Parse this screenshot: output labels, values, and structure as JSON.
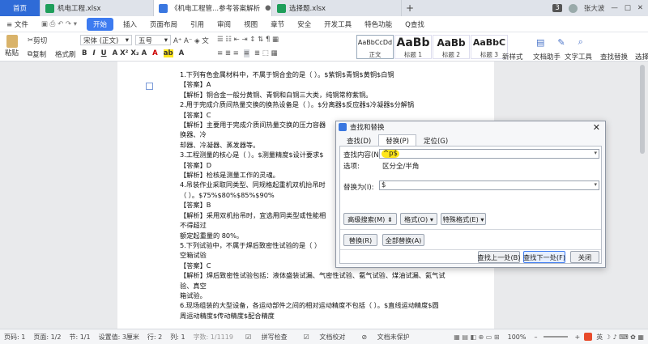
{
  "tabs": [
    {
      "label": "首页"
    },
    {
      "label": "机电工程.xlsx"
    },
    {
      "label": "《机电工程管...参考答案解析"
    },
    {
      "label": "选择题.xlsx"
    }
  ],
  "tabbar_right": {
    "badge": "3",
    "user": "张大波"
  },
  "menu": {
    "file": "≡ 文件",
    "items": [
      "开始",
      "插入",
      "页面布局",
      "引用",
      "审阅",
      "视图",
      "章节",
      "安全",
      "开发工具",
      "特色功能"
    ],
    "search": "Q查找"
  },
  "ribbon": {
    "paste": "粘贴",
    "cut": "剪切",
    "copy": "复制",
    "format_painter": "格式刷",
    "font": "宋体 (正文)",
    "size": "五号",
    "styles": [
      {
        "sample": "AaBbCcDd",
        "name": "正文"
      },
      {
        "sample": "AaBb",
        "name": "标题 1"
      },
      {
        "sample": "AaBb",
        "name": "标题 2"
      },
      {
        "sample": "AaBbC",
        "name": "标题 3"
      }
    ],
    "new_style": "新样式",
    "doc_helper": "文档助手",
    "text_tools": "文字工具",
    "find_replace": "查找替换",
    "select": "选择"
  },
  "document": {
    "lines": [
      "1.下列有色金属材料中，不属于铜合金的是（  ）。$紫铜$青铜$黄铜$白铜",
      "【答案】A",
      "【解析】铜合金一般分黄铜、青铜和白铜三大类，纯铜常称紫铜。",
      "2.用于完成介质间热量交换的换热设备是（  ）。$分离器$反应器$冷凝器$分解锅",
      "【答案】C",
      "【解析】主要用于完成介质间热量交换的压力容器",
      "换器、冷",
      "却器、冷凝器、蒸发器等。",
      "3.工程测量的核心是（  ）。$测量精度$设计要求$",
      "【答案】D",
      "【解析】检核是测量工作的灵魂。",
      "4.吊装作业采取同类型、同规格起重机双机抬吊时",
      "（  ）。$75%$80%$85%$90%",
      "【答案】B",
      "【解析】采用双机抬吊时，宜选用同类型或性能相",
      "不得超过",
      "额定起重量的  80%。",
      "5.下列试验中，不属于焊后致密性试验的是（  ）",
      "空箱试验",
      "【答案】C",
      "【解析】焊后致密性试验包括：液体盛装试漏、气密性试验、氨气试验、煤油试漏、氦气试",
      "验、真空",
      "箱试验。",
      "6.现场组装的大型设备，各运动部件之间的相对运动精度不包括（  ）。$直线运动精度$圆",
      "周运动精度$传动精度$配合精度"
    ]
  },
  "dialog": {
    "title": "查找和替换",
    "tabs": [
      "查找(D)",
      "替换(P)",
      "定位(G)"
    ],
    "find_label": "查找内容(N):",
    "find_value": "^p$",
    "options_label": "选项:",
    "options_value": "区分全/半角",
    "replace_label": "替换为(I):",
    "replace_value": "$",
    "btn_advanced": "高级搜索(M) ⇟",
    "btn_format": "格式(O) ▾",
    "btn_special": "特殊格式(E) ▾",
    "btn_replace": "替换(R)",
    "btn_replace_all": "全部替换(A)",
    "btn_prev": "查找上一处(B)",
    "btn_next": "查找下一处(F)",
    "btn_close": "关闭"
  },
  "status": {
    "page": "页码: 1",
    "pages": "页面: 1/2",
    "section": "节: 1/1",
    "setting": "设置值: 3厘米",
    "row": "行: 2",
    "col": "列: 1",
    "words": "字数: 1/1119",
    "spell": "拼写检查",
    "proof": "文档校对",
    "protect": "文档未保护",
    "zoom": "100%"
  },
  "colors": {
    "accent": "#3d7bf0",
    "highlight": "#ffe61a",
    "excel": "#1e9e5a",
    "word": "#3a77e0"
  }
}
